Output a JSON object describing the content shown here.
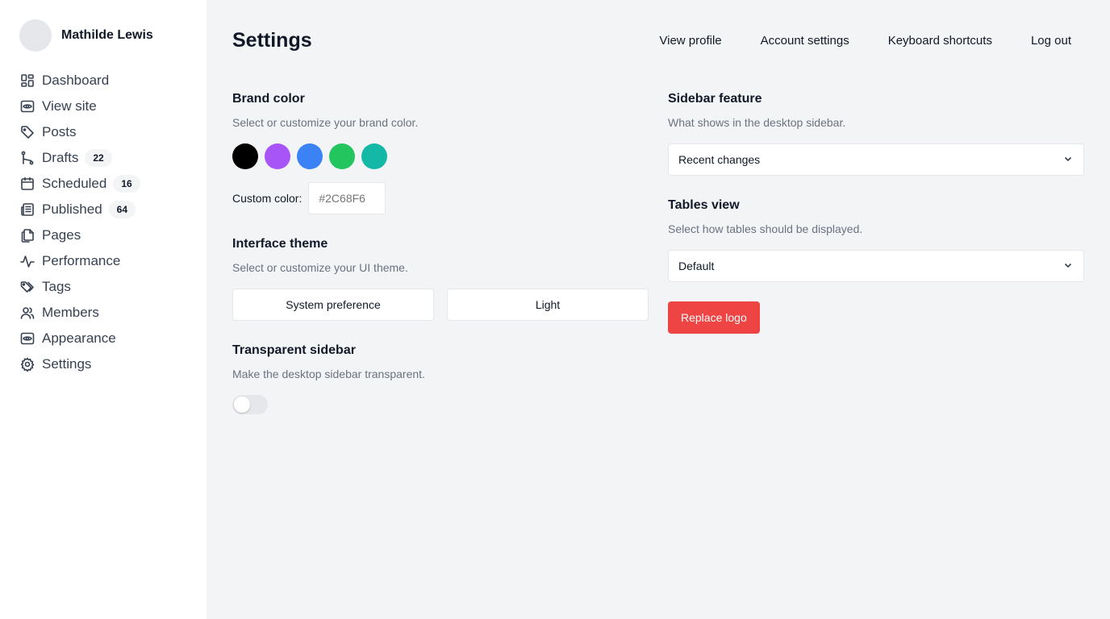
{
  "user": {
    "name": "Mathilde Lewis"
  },
  "nav": [
    {
      "label": "Dashboard",
      "icon": "dashboard-icon"
    },
    {
      "label": "View site",
      "icon": "eye-icon"
    },
    {
      "label": "Posts",
      "icon": "tag-icon"
    },
    {
      "label": "Drafts",
      "icon": "git-branch-icon",
      "badge": "22"
    },
    {
      "label": "Scheduled",
      "icon": "calendar-icon",
      "badge": "16"
    },
    {
      "label": "Published",
      "icon": "newspaper-icon",
      "badge": "64"
    },
    {
      "label": "Pages",
      "icon": "pages-icon"
    },
    {
      "label": "Performance",
      "icon": "activity-icon"
    },
    {
      "label": "Tags",
      "icon": "tags-icon"
    },
    {
      "label": "Members",
      "icon": "users-icon"
    },
    {
      "label": "Appearance",
      "icon": "eye-icon"
    },
    {
      "label": "Settings",
      "icon": "gear-icon"
    }
  ],
  "header": {
    "title": "Settings",
    "links": [
      "View profile",
      "Account settings",
      "Keyboard shortcuts",
      "Log out"
    ]
  },
  "brand_color": {
    "title": "Brand color",
    "description": "Select or customize your brand color.",
    "swatches": [
      "#000000",
      "#a855f7",
      "#3b82f6",
      "#22c55e",
      "#14b8a6"
    ],
    "custom_label": "Custom color:",
    "custom_placeholder": "#2C68F6"
  },
  "interface_theme": {
    "title": "Interface theme",
    "description": "Select or customize your UI theme.",
    "options": [
      "System preference",
      "Light"
    ]
  },
  "transparent_sidebar": {
    "title": "Transparent sidebar",
    "description": "Make the desktop sidebar transparent.",
    "enabled": false
  },
  "sidebar_feature": {
    "title": "Sidebar feature",
    "description": "What shows in the desktop sidebar.",
    "selected": "Recent changes"
  },
  "tables_view": {
    "title": "Tables view",
    "description": "Select how tables should be displayed.",
    "selected": "Default"
  },
  "replace_logo": {
    "label": "Replace logo",
    "color": "#ef4444"
  }
}
